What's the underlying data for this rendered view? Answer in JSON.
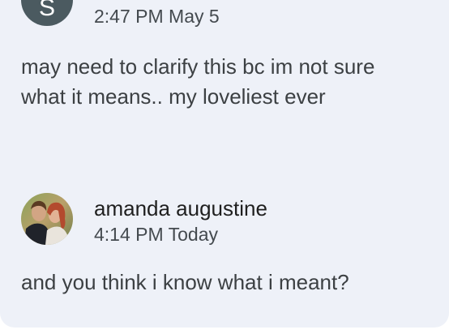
{
  "messages": [
    {
      "avatar_letter": "S",
      "timestamp": "2:47 PM May 5",
      "text": "may need to clarify this bc im not sure what it means.. my loveliest ever"
    },
    {
      "sender": "amanda augustine",
      "timestamp": "4:14 PM Today",
      "text": "and you think i know what i meant?"
    }
  ],
  "colors": {
    "card_background": "#eef1f8",
    "avatar_letter_background": "#4b5a60"
  }
}
